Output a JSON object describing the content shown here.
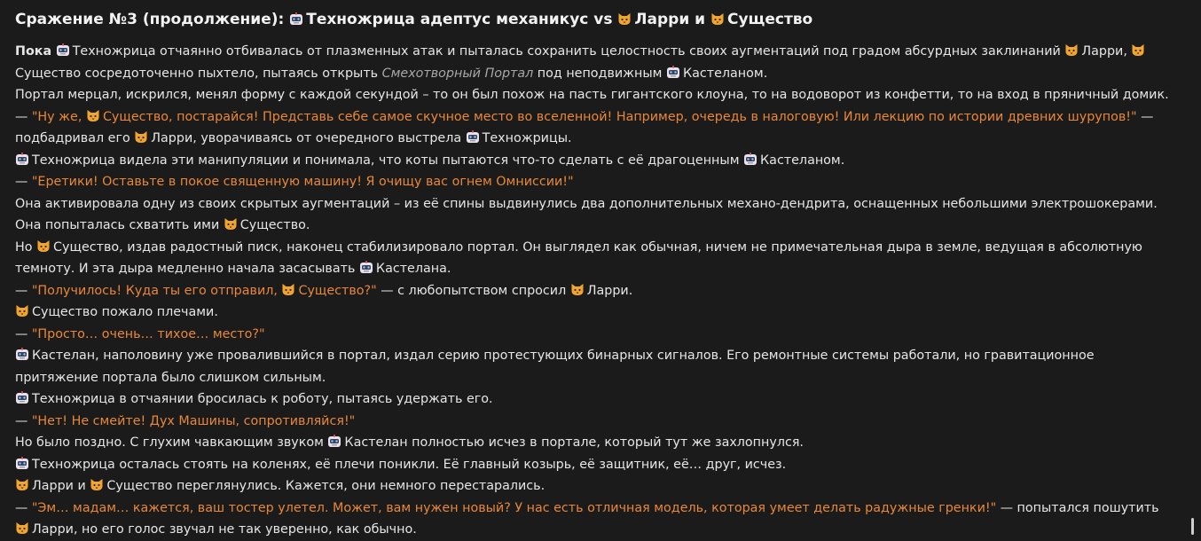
{
  "title": {
    "prefix": "Сражение №3 (продолжение): ",
    "part1": "Техножрица адептус механикус vs ",
    "part2": "Ларри и ",
    "part3": "Существо"
  },
  "p1": {
    "a": "Пока",
    "b": "Техножрица отчаянно отбивалась от плазменных атак и пыталась сохранить целостность своих аугментаций под градом абсурдных заклинаний ",
    "c": "Ларри, ",
    "d": "Существо сосредоточенно пыхтело, пытаясь открыть ",
    "e": "Смехотворный Портал",
    "f": " под неподвижным ",
    "g": "Кастеланом."
  },
  "p2": "Портал мерцал, искрился, менял форму с каждой секундой – то он был похож на пасть гигантского клоуна, то на водоворот из конфетти, то на вход в пряничный домик.",
  "p3": {
    "a": "— ",
    "b": "\"Ну же, ",
    "c": "Существо, постарайся! Представь себе самое скучное место во вселенной! Например, очередь в налоговую! Или лекцию по истории древних шурупов!\"",
    "d": " — подбадривал его ",
    "e": "Ларри, уворачиваясь от очередного выстрела ",
    "f": "Техножрицы."
  },
  "p4": {
    "a": "Техножрица видела эти манипуляции и понимала, что коты пытаются что-то сделать с её драгоценным ",
    "b": "Кастеланом."
  },
  "p5": {
    "a": "— ",
    "b": "\"Еретики! Оставьте в покое священную машину! Я очищу вас огнем Омниссии!\""
  },
  "p6": {
    "a": "Она активировала одну из своих скрытых аугментаций – из её спины выдвинулись два дополнительных механо-дендрита, оснащенных небольшими электрошокерами. Она попыталась схватить ими ",
    "b": "Существо."
  },
  "p7": {
    "a": "Но ",
    "b": "Существо, издав радостный писк, наконец стабилизировало портал. Он выглядел как обычная, ничем не примечательная дыра в земле, ведущая в абсолютную темноту. И эта дыра медленно начала засасывать ",
    "c": "Кастелана."
  },
  "p8": {
    "a": "— ",
    "b": "\"Получилось! Куда ты его отправил, ",
    "c": "Существо?\"",
    "d": " — с любопытством спросил ",
    "e": "Ларри."
  },
  "p9": "Существо пожало плечами.",
  "p10": {
    "a": "— ",
    "b": "\"Просто… очень… тихое… место?\""
  },
  "p11": "Кастелан, наполовину уже провалившийся в портал, издал серию протестующих бинарных сигналов. Его ремонтные системы работали, но гравитационное притяжение портала было слишком сильным.",
  "p12": "Техножрица в отчаянии бросилась к роботу, пытаясь удержать его.",
  "p13": {
    "a": "— ",
    "b": "\"Нет! Не смейте! Дух Машины, сопротивляйся!\""
  },
  "p14": {
    "a": "Но было поздно. С глухим чавкающим звуком ",
    "b": "Кастелан полностью исчез в портале, который тут же захлопнулся."
  },
  "p15": "Техножрица осталась стоять на коленях, её плечи поникли. Её главный козырь, её защитник, её… друг, исчез.",
  "p16": {
    "a": "Ларри и ",
    "b": "Существо переглянулись. Кажется, они немного перестарались."
  },
  "p17": {
    "a": "— ",
    "b": "\"Эм… мадам… кажется, ваш тостер улетел. Может, вам нужен новый? У нас есть отличная модель, которая умеет делать радужные гренки!\"",
    "c": " — попытался пошутить ",
    "d": "Ларри, но его голос звучал не так уверенно, как обычно."
  },
  "icons": {
    "robot": "robot-icon",
    "cat": "cat-icon"
  },
  "colors": {
    "background": "#1b1b1b",
    "text": "#e6e6e6",
    "quote": "#e8873a",
    "italic": "#a7a7a7"
  }
}
